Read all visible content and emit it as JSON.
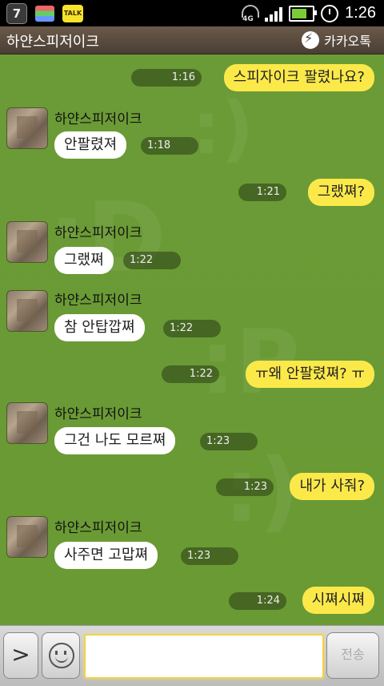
{
  "statusbar": {
    "notif_count": "7",
    "talk_badge": "TALK",
    "network": "4G",
    "time": "1:26"
  },
  "titlebar": {
    "title": "하얀스피저이크",
    "brand": "카카오톡"
  },
  "messages": [
    {
      "side": "me",
      "text": "스피자이크 팔렸나요?",
      "time": "1:16"
    },
    {
      "side": "them",
      "sender": "하얀스피저이크",
      "text": "안팔렸져",
      "time": "1:18"
    },
    {
      "side": "me",
      "text": "그랬쪄?",
      "time": "1:21"
    },
    {
      "side": "them",
      "sender": "하얀스피저이크",
      "text": "그랬쪄",
      "time": "1:22"
    },
    {
      "side": "them",
      "sender": "하얀스피저이크",
      "text": "참 안탑깝쪄",
      "time": "1:22"
    },
    {
      "side": "me",
      "text": "ㅠ왜 안팔렸쪄? ㅠ",
      "time": "1:22"
    },
    {
      "side": "them",
      "sender": "하얀스피저이크",
      "text": "그건 나도 모르쪄",
      "time": "1:23"
    },
    {
      "side": "me",
      "text": "내가 사줘?",
      "time": "1:23"
    },
    {
      "side": "them",
      "sender": "하얀스피저이크",
      "text": "사주면 고맙쪄",
      "time": "1:23"
    },
    {
      "side": "me",
      "text": "시쪄시쪄",
      "time": "1:24"
    }
  ],
  "inputbar": {
    "more_glyph": ">",
    "message_value": "",
    "send_label": "전송"
  }
}
